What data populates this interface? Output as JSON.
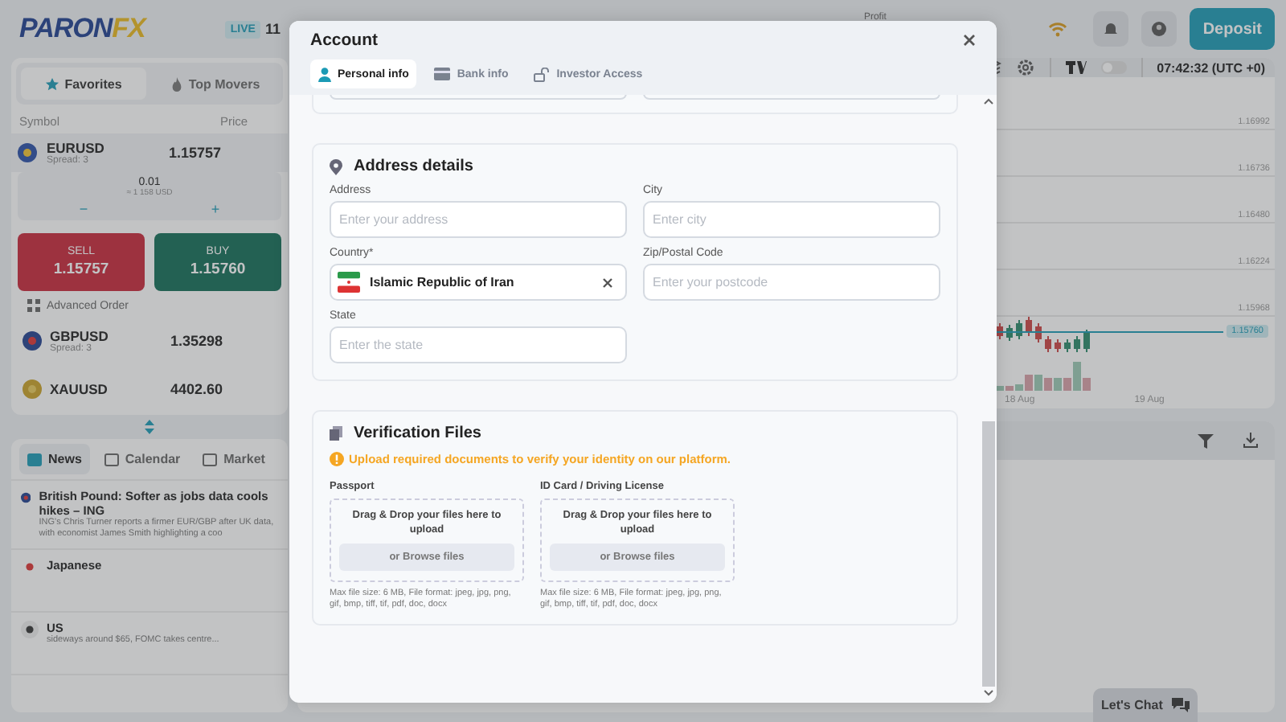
{
  "top_bar": {
    "logo": {
      "text": "PARON",
      "accent": "FX"
    },
    "account_badge": "LIVE",
    "balance": "11",
    "profit_label": "Profit",
    "deposit_button": "Deposit"
  },
  "market_panel": {
    "tabs": [
      {
        "label": "Favorites",
        "selected": true
      },
      {
        "label": "Top Movers",
        "selected": false
      }
    ],
    "columns": [
      "Symbol",
      "Price"
    ],
    "symbols": [
      {
        "symbol": "EURUSD",
        "spread": "Spread: 3",
        "price": "1.15757",
        "selected": true
      },
      {
        "symbol": "GBPUSD",
        "spread": "Spread: 3",
        "price": "1.35298",
        "selected": false
      },
      {
        "symbol": "XAUUSD",
        "price": "4402.60",
        "selected": false
      }
    ],
    "lot": {
      "value": "0.01",
      "equivalent": "≈ 1 158 USD",
      "minus": "−",
      "plus": "+"
    },
    "sell": {
      "label": "SELL",
      "price": "1.15757"
    },
    "buy": {
      "label": "BUY",
      "price": "1.15760"
    },
    "advanced_order": "Advanced Order"
  },
  "news_panel": {
    "tabs": [
      {
        "label": "News",
        "selected": true
      },
      {
        "label": "Calendar",
        "selected": false
      },
      {
        "label": "Market",
        "selected": false
      }
    ],
    "items": [
      {
        "title": "British Pound: Softer as jobs data cools hikes – ING",
        "summary": "ING's Chris Turner reports a firmer EUR/GBP after UK data, with economist James Smith highlighting a coo"
      },
      {
        "title": "Japanese"
      },
      {
        "title": "US",
        "summary": "sideways around $65, FOMC takes centre..."
      }
    ]
  },
  "chart_toolbar": {
    "time": "07:42:32 (UTC +0)",
    "tv_toggle_on": false
  },
  "chart": {
    "price_labels": [
      "1.16992",
      "1.16736",
      "1.16480",
      "1.16224",
      "1.15968"
    ],
    "current_price": "1.15760",
    "date_labels": [
      "18 Aug",
      "19 Aug"
    ]
  },
  "chat_button": "Let's Chat",
  "modal": {
    "title": "Account",
    "tabs": [
      {
        "label": "Personal info",
        "selected": true
      },
      {
        "label": "Bank info",
        "selected": false
      },
      {
        "label": "Investor Access",
        "selected": false
      }
    ],
    "address": {
      "title": "Address details",
      "fields": [
        {
          "kind": "text",
          "label": "Address",
          "placeholder": "Enter your address"
        },
        {
          "kind": "text",
          "label": "City",
          "placeholder": "Enter city"
        },
        {
          "kind": "select",
          "label": "Country*",
          "value": "Islamic Republic of Iran"
        },
        {
          "kind": "text",
          "label": "Zip/Postal Code",
          "placeholder": "Enter your postcode"
        },
        {
          "kind": "text",
          "label": "State",
          "placeholder": "Enter the state"
        }
      ]
    },
    "verification": {
      "title": "Verification Files",
      "warning": "Upload required documents to verify your identity on our platform.",
      "uploads": [
        {
          "label": "Passport",
          "drop_text": "Drag & Drop your files here to upload",
          "browse": "or Browse files",
          "note": "Max file size: 6 MB, File format: jpeg, jpg, png, gif, bmp, tiff, tif, pdf, doc, docx"
        },
        {
          "label": "ID Card / Driving License",
          "drop_text": "Drag & Drop your files here to upload",
          "browse": "or Browse files",
          "note": "Max file size: 6 MB, File format: jpeg, jpg, png, gif, bmp, tiff, tif, pdf, doc, docx"
        }
      ]
    }
  }
}
